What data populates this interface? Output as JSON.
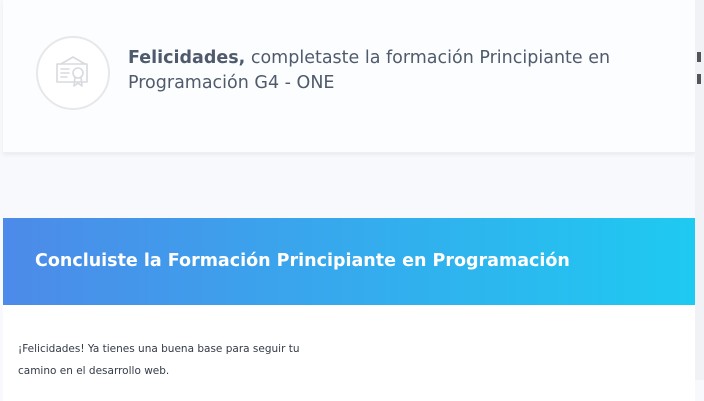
{
  "certificate": {
    "icon": "certificate-icon",
    "bold_text": "Felicidades,",
    "message": " completaste la formación Principiante en Programación G4 - ONE"
  },
  "banner": {
    "title": "Concluiste la Formación Principiante en Programación",
    "gradient_start": "#4d8ae9",
    "gradient_end": "#1ecaf1"
  },
  "body": {
    "text": "¡Felicidades! Ya tienes una buena base para seguir tu camino en el desarrollo web."
  }
}
